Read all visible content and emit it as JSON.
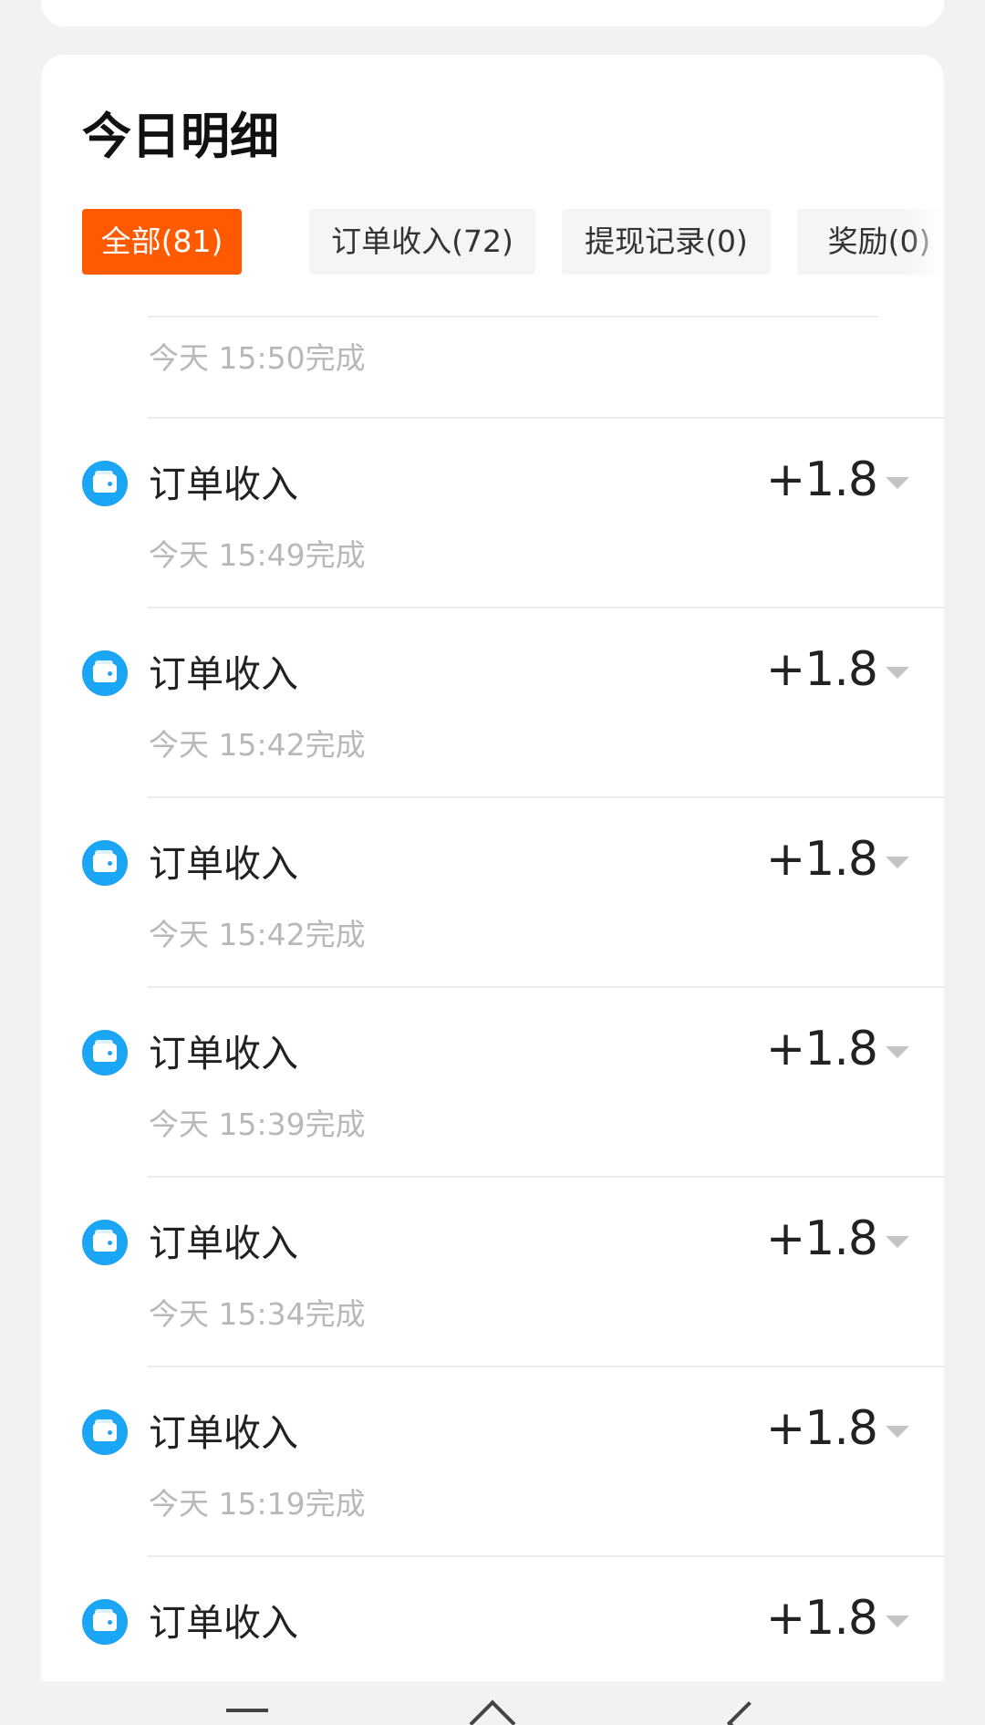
{
  "header": {
    "title": "今日明细"
  },
  "tabs": [
    {
      "label": "全部(81)",
      "active": true
    },
    {
      "label": "订单收入(72)",
      "active": false
    },
    {
      "label": "提现记录(0)",
      "active": false
    },
    {
      "label": "奖励(0)",
      "active": false
    }
  ],
  "list": {
    "partial_time": "今天 15:50完成",
    "items": [
      {
        "label": "订单收入",
        "amount": "+1.8",
        "time": "今天 15:49完成",
        "icon": "wallet-icon"
      },
      {
        "label": "订单收入",
        "amount": "+1.8",
        "time": "今天 15:42完成",
        "icon": "wallet-icon"
      },
      {
        "label": "订单收入",
        "amount": "+1.8",
        "time": "今天 15:42完成",
        "icon": "wallet-icon"
      },
      {
        "label": "订单收入",
        "amount": "+1.8",
        "time": "今天 15:39完成",
        "icon": "wallet-icon"
      },
      {
        "label": "订单收入",
        "amount": "+1.8",
        "time": "今天 15:34完成",
        "icon": "wallet-icon"
      },
      {
        "label": "订单收入",
        "amount": "+1.8",
        "time": "今天 15:19完成",
        "icon": "wallet-icon"
      },
      {
        "label": "订单收入",
        "amount": "+1.8",
        "time": "",
        "icon": "wallet-icon"
      }
    ]
  },
  "colors": {
    "accent": "#ff5a00",
    "icon_blue": "#1ba5f5",
    "muted_text": "#b8b8b8",
    "background": "#f2f2f2"
  },
  "navigation": {
    "buttons": [
      "menu-icon",
      "home-icon",
      "back-icon"
    ]
  }
}
